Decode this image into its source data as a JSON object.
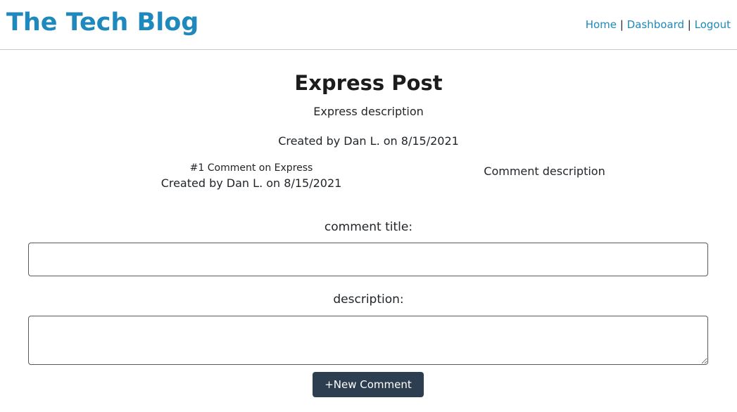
{
  "header": {
    "site_title": "The Tech Blog",
    "nav": {
      "home": "Home",
      "dashboard": "Dashboard",
      "logout": "Logout",
      "separator": "|"
    }
  },
  "post": {
    "title": "Express Post",
    "description": "Express description",
    "meta": "Created by Dan L. on 8/15/2021"
  },
  "comments": [
    {
      "title": "#1 Comment on Express",
      "meta": "Created by Dan L. on 8/15/2021",
      "description": "Comment description"
    }
  ],
  "form": {
    "title_label": "comment title:",
    "title_value": "",
    "description_label": "description:",
    "description_value": "",
    "submit_label": "+New Comment"
  },
  "colors": {
    "brand": "#1f88bc",
    "button_bg": "#2c3e50",
    "button_text": "#ffffff"
  }
}
